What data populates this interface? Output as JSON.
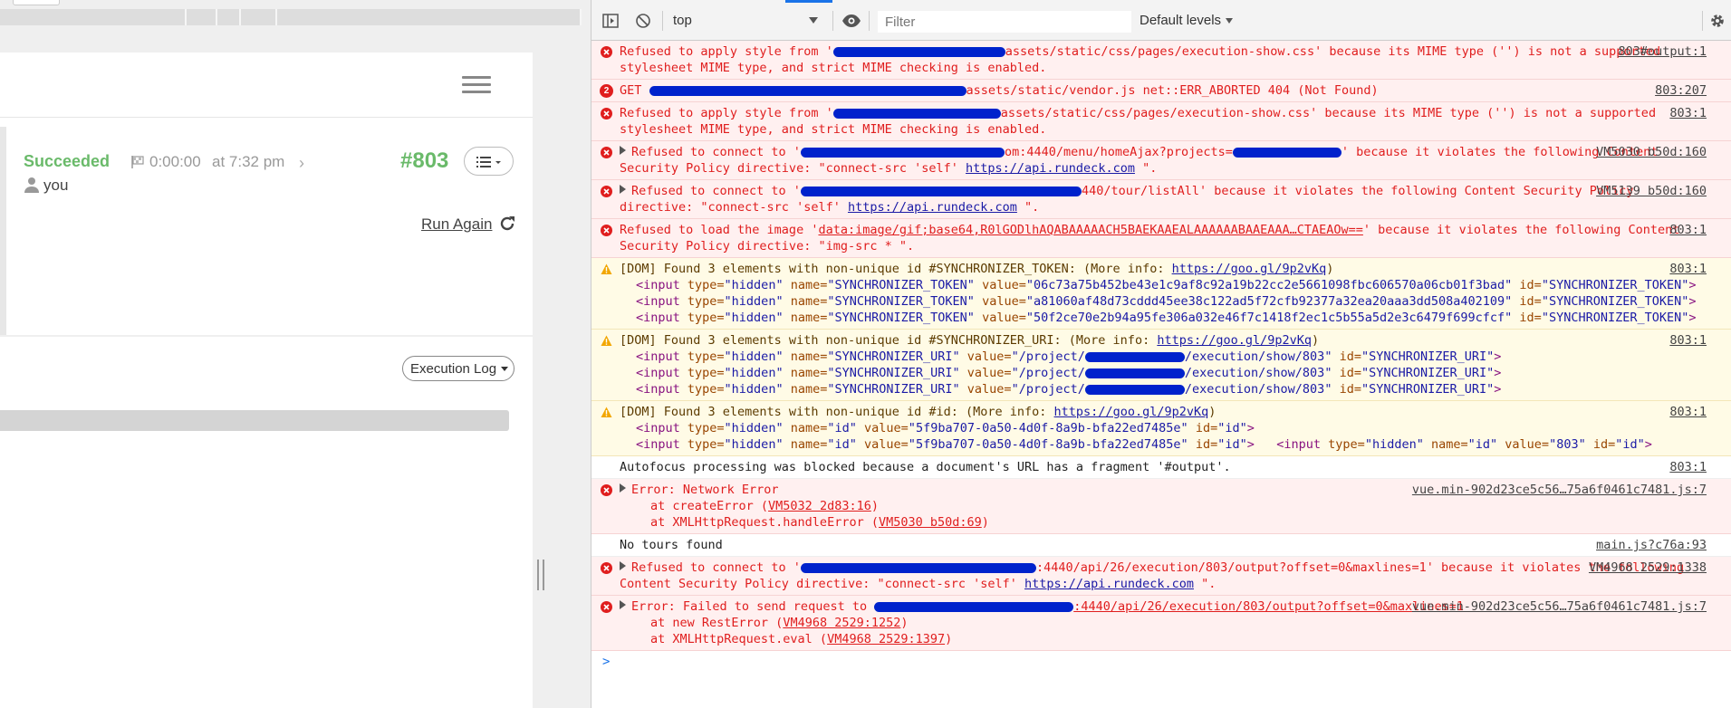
{
  "page": {
    "status": "Succeeded",
    "duration": "0:00:00",
    "time": "at 7:32 pm",
    "execution_number": "#803",
    "user": "you",
    "run_again": "Run Again",
    "execution_log_button": "Execution Log"
  },
  "devtools": {
    "context": "top",
    "filter_placeholder": "Filter",
    "levels": "Default levels",
    "messages": [
      {
        "level": "error",
        "text_before": "Refused to apply style from '",
        "text_after": "assets/static/css/pages/execution-show.css' because its MIME type ('') is not a supported stylesheet MIME type, and strict MIME checking is enabled.",
        "source": "803#output:1"
      },
      {
        "level": "error",
        "count": "2",
        "text_before": "GET ",
        "text_after": "assets/static/vendor.js net::ERR_ABORTED 404 (Not Found)",
        "source": "803:207"
      },
      {
        "level": "error",
        "text_before": "Refused to apply style from '",
        "text_after": "assets/static/css/pages/execution-show.css' because its MIME type ('') is not a supported stylesheet MIME type, and strict MIME checking is enabled.",
        "source": "803:1"
      },
      {
        "level": "error",
        "text_before": "Refused to connect to '",
        "text_mid": "om:4440/menu/homeAjax?projects=",
        "text_after": "' because it violates the following Content Security Policy directive: \"connect-src 'self' ",
        "link": "https://api.rundeck.com",
        "text_end": " \".",
        "source": "VM5030 b50d:160"
      },
      {
        "level": "error",
        "text_before": "Refused to connect to '",
        "text_after": "440/tour/listAll' because it violates the following Content Security Policy directive: \"connect-src 'self' ",
        "link": "https://api.rundeck.com",
        "text_end": " \".",
        "source": "VM5139 b50d:160"
      },
      {
        "level": "error",
        "text_before": "Refused to load the image '",
        "link_red": "data:image/gif;base64,R0lGODlhAQABAAAAACH5BAEKAAEALAAAAAABAAEAAA…CTAEAOw==",
        "text_after": "' because it violates the following Content Security Policy directive: \"img-src * \".",
        "source": "803:1"
      },
      {
        "level": "warn",
        "text": "[DOM] Found 3 elements with non-unique id #SYNCHRONIZER_TOKEN: (More info: ",
        "link": "https://goo.gl/9p2vKq",
        "text_end": ")",
        "source": "803:1",
        "lines": [
          {
            "name": "SYNCHRONIZER_TOKEN",
            "value": "06c73a75b452be43e1c9af8c92a19b22cc2e5661098fbc606570a06cb01f3bad",
            "id": "SYNCHRONIZER_TOKEN"
          },
          {
            "name": "SYNCHRONIZER_TOKEN",
            "value": "a81060af48d73cddd45ee38c122ad5f72cfb92377a32ea20aaa3dd508a402109",
            "id": "SYNCHRONIZER_TOKEN"
          },
          {
            "name": "SYNCHRONIZER_TOKEN",
            "value": "50f2ce70e2b94a95fe306a032e46f7c1418f2ec1c5b55a5d2e3c6479f699cfcf",
            "id": "SYNCHRONIZER_TOKEN"
          }
        ]
      },
      {
        "level": "warn",
        "text": "[DOM] Found 3 elements with non-unique id #SYNCHRONIZER_URI: (More info: ",
        "link": "https://goo.gl/9p2vKq",
        "text_end": ")",
        "source": "803:1",
        "lines": [
          {
            "name": "SYNCHRONIZER_URI",
            "value_before": "/project/",
            "value_after": "/execution/show/803",
            "id": "SYNCHRONIZER_URI"
          },
          {
            "name": "SYNCHRONIZER_URI",
            "value_before": "/project/",
            "value_after": "/execution/show/803",
            "id": "SYNCHRONIZER_URI"
          },
          {
            "name": "SYNCHRONIZER_URI",
            "value_before": "/project/",
            "value_after": "/execution/show/803",
            "id": "SYNCHRONIZER_URI"
          }
        ]
      },
      {
        "level": "warn",
        "text": "[DOM] Found 3 elements with non-unique id #id: (More info: ",
        "link": "https://goo.gl/9p2vKq",
        "text_end": ")",
        "source": "803:1",
        "lines": [
          {
            "name": "id",
            "value": "5f9ba707-0a50-4d0f-8a9b-bfa22ed7485e",
            "id": "id"
          },
          {
            "name": "id",
            "value": "5f9ba707-0a50-4d0f-8a9b-bfa22ed7485e",
            "id": "id",
            "extra_name": "id",
            "extra_value": "803",
            "extra_id": "id"
          }
        ]
      },
      {
        "level": "info",
        "text": "Autofocus processing was blocked because a document's URL has a fragment '#output'.",
        "source": "803:1"
      },
      {
        "level": "error",
        "text": "Error: Network Error",
        "source": "vue.min-902d23ce5c56…75a6f0461c7481.js:7",
        "stack": [
          {
            "fn": "at createError (",
            "ref": "VM5032 2d83:16",
            "end": ")"
          },
          {
            "fn": "at XMLHttpRequest.handleError (",
            "ref": "VM5030 b50d:69",
            "end": ")"
          }
        ]
      },
      {
        "level": "info",
        "text": "No tours found",
        "source": "main.js?c76a:93"
      },
      {
        "level": "error",
        "text_before": "Refused to connect to '",
        "text_after": ":4440/api/26/execution/803/output?offset=0&maxlines=1' because it violates the following Content Security Policy directive: \"connect-src 'self' ",
        "link": "https://api.rundeck.com",
        "text_end": " \".",
        "source": "VM4968 2529:1338"
      },
      {
        "level": "error",
        "text_before": "Error: Failed to send request to ",
        "link_red": ":4440/api/26/execution/803/output?offset=0&maxlines=1",
        "source": "vue.min-902d23ce5c56…75a6f0461c7481.js:7",
        "stack": [
          {
            "fn": "at new RestError (",
            "ref": "VM4968 2529:1252",
            "end": ")"
          },
          {
            "fn": "at XMLHttpRequest.eval (",
            "ref": "VM4968 2529:1397",
            "end": ")"
          }
        ]
      }
    ],
    "prompt": ">"
  }
}
